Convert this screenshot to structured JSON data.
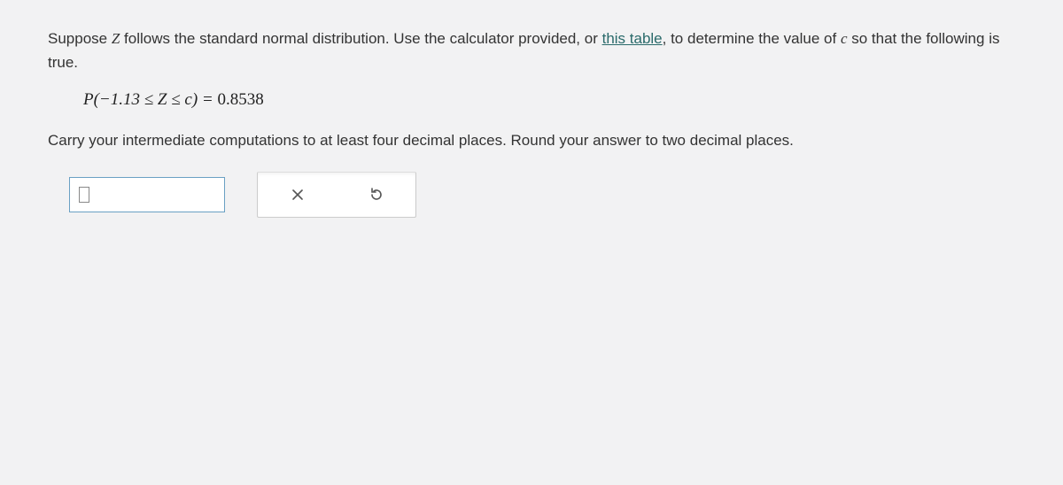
{
  "intro": {
    "prefix": "Suppose ",
    "varZ": "Z",
    "mid": " follows the standard normal distribution. Use the calculator provided, or ",
    "link_text": "this table",
    "after_link": ", to determine the value of ",
    "varC": "c",
    "suffix": " so that the following is true."
  },
  "equation": {
    "lhs": "P(−1.13 ≤ Z ≤ c) = ",
    "rhs": "0.8538"
  },
  "instructions": "Carry your intermediate computations to at least four decimal places. Round your answer to two decimal places.",
  "answer_value": "",
  "buttons": {
    "clear": "clear",
    "reset": "reset"
  }
}
